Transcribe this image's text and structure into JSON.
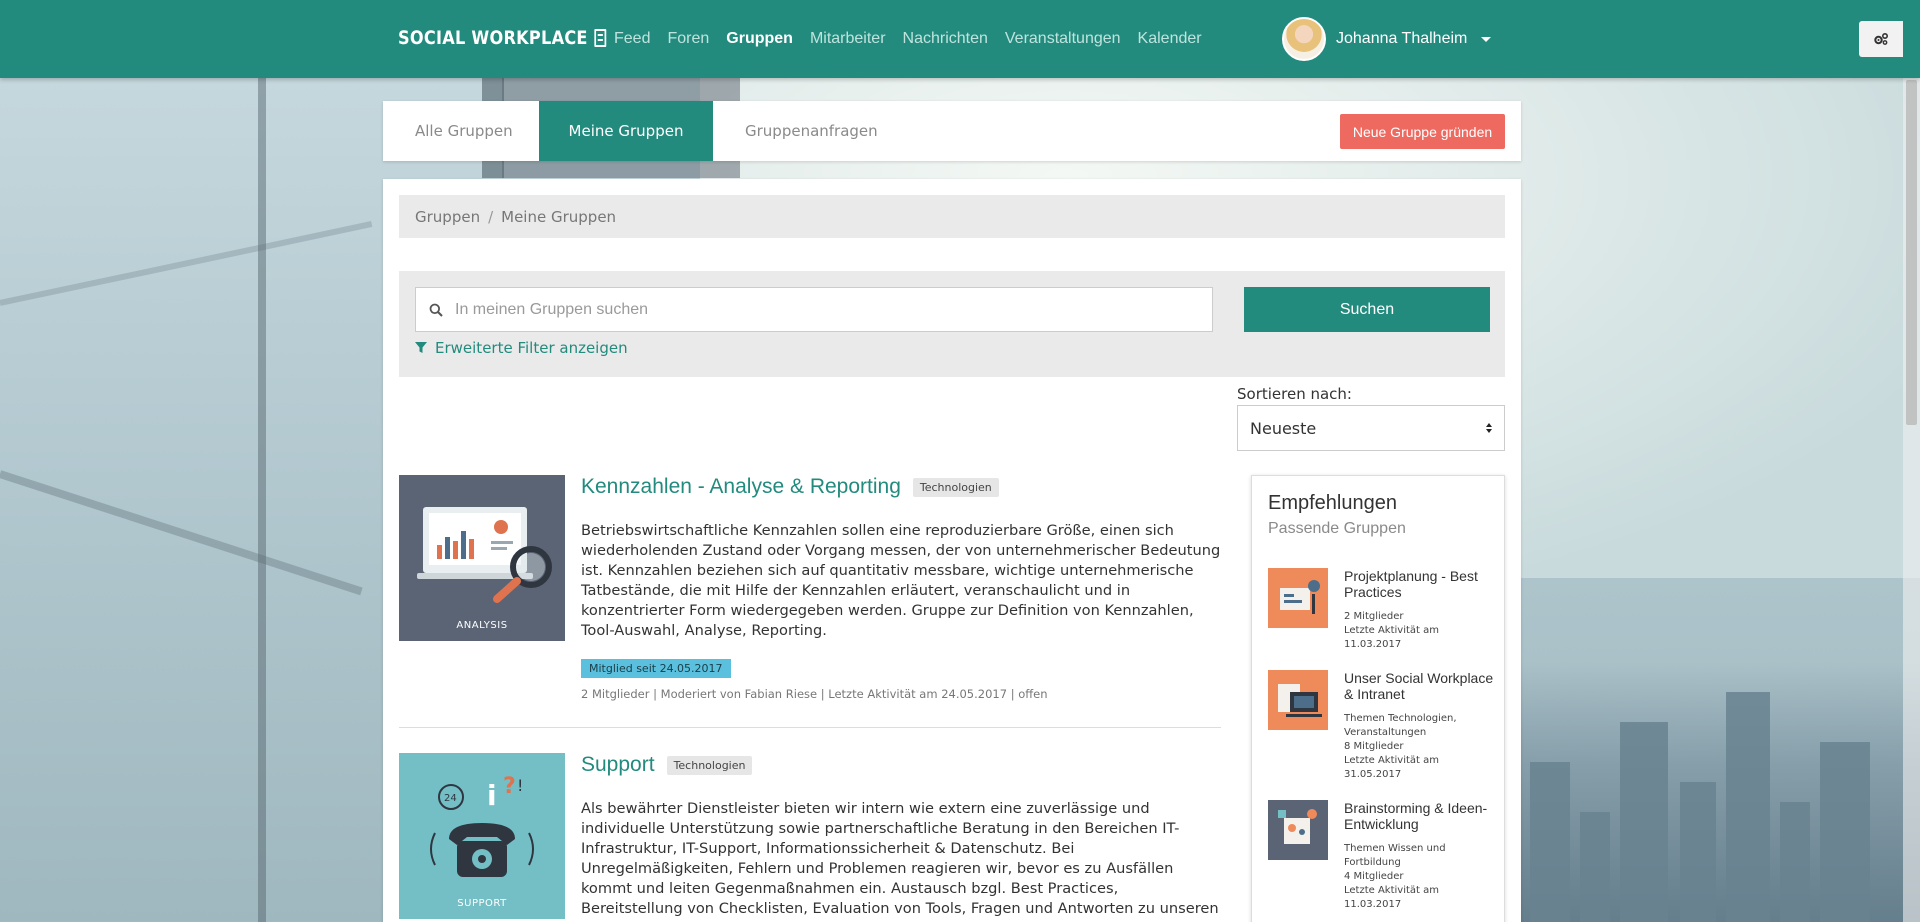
{
  "brand": {
    "name": "SOCIAL WORKPLACE"
  },
  "nav": [
    {
      "label": "Feed"
    },
    {
      "label": "Foren"
    },
    {
      "label": "Gruppen",
      "active": true
    },
    {
      "label": "Mitarbeiter"
    },
    {
      "label": "Nachrichten"
    },
    {
      "label": "Veranstaltungen"
    },
    {
      "label": "Kalender"
    }
  ],
  "user": {
    "name": "Johanna Thalheim"
  },
  "tabs": {
    "all": "Alle Gruppen",
    "mine": "Meine Gruppen",
    "requests": "Gruppenanfragen",
    "new_group": "Neue Gruppe gründen"
  },
  "breadcrumb": {
    "root": "Gruppen",
    "separator": "/",
    "current": "Meine Gruppen"
  },
  "search": {
    "placeholder": "In meinen Gruppen suchen",
    "button": "Suchen",
    "filter_link": "Erweiterte Filter anzeigen"
  },
  "sort": {
    "label": "Sortieren nach:",
    "selected": "Neueste"
  },
  "groups": [
    {
      "title": "Kennzahlen - Analyse & Reporting",
      "tag": "Technologien",
      "thumb_caption": "ANALYSIS",
      "description": "Betriebswirtschaftliche Kennzahlen sollen eine reproduzierbare Größe, einen sich wiederholenden Zustand oder Vorgang messen, der von unternehmerischer Bedeutung ist. Kennzahlen beziehen sich auf quantitativ messbare, wichtige unternehmerische Tatbestände, die mit Hilfe der Kennzahlen erläutert, veranschaulicht und in konzentrierter Form wiedergegeben werden. Gruppe zur Definition von Kennzahlen, Tool-Auswahl, Analyse, Reporting.",
      "member_since": "Mitglied seit 24.05.2017",
      "meta": "2 Mitglieder | Moderiert von Fabian Riese | Letzte Aktivität am 24.05.2017 | offen"
    },
    {
      "title": "Support",
      "tag": "Technologien",
      "thumb_caption": "SUPPORT",
      "description": "Als bewährter Dienstleister bieten wir intern wie extern eine zuverlässige und individuelle Unterstützung sowie partnerschaftliche Beratung in den Bereichen IT-Infrastruktur, IT-Support, Informationssicherheit & Datenschutz. Bei Unregelmäßigkeiten, Fehlern und Problemen reagieren wir, bevor es zu Ausfällen kommt und leiten Gegenmaßnahmen ein. Austausch bzgl. Best Practices, Bereitstellung von Checklisten, Evaluation von Tools, Fragen und Antworten zu unseren Prozessen."
    }
  ],
  "recommendations": {
    "title": "Empfehlungen",
    "subtitle": "Passende Gruppen",
    "items": [
      {
        "title": "Projektplanung - Best Practices",
        "lines": [
          "2 Mitglieder",
          "Letzte Aktivität am 11.03.2017"
        ]
      },
      {
        "title": "Unser Social Workplace & Intranet",
        "lines": [
          "Themen Technologien, Veranstaltungen",
          "8 Mitglieder",
          "Letzte Aktivität am 31.05.2017"
        ]
      },
      {
        "title": "Brainstorming & Ideen-Entwicklung",
        "lines": [
          "Themen Wissen und Fortbildung",
          "4 Mitglieder",
          "Letzte Aktivität am 11.03.2017"
        ]
      }
    ]
  },
  "colors": {
    "primary": "#228b7e",
    "accent": "#ee6a60",
    "badge": "#5bc0de"
  }
}
